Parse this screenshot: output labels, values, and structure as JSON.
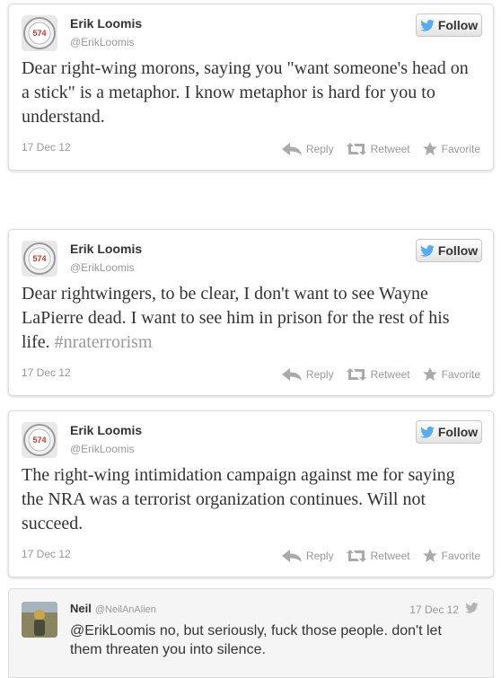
{
  "colors": {
    "twitter_blue": "#55acee",
    "muted": "#999999"
  },
  "tweets": [
    {
      "name": "Erik Loomis",
      "handle": "@ErikLoomis",
      "follow_label": "Follow",
      "text": "Dear right-wing morons, saying you \"want someone's head on a stick\" is a metaphor. I know metaphor is hard for you to understand.",
      "hashtag": "",
      "date": "17 Dec 12",
      "reply_label": "Reply",
      "retweet_label": "Retweet",
      "favorite_label": "Favorite",
      "avatar_text": "574"
    },
    {
      "name": "Erik Loomis",
      "handle": "@ErikLoomis",
      "follow_label": "Follow",
      "text": "Dear rightwingers, to be clear, I don't want to see Wayne LaPierre dead. I want to see him in prison for the rest of his life.",
      "hashtag": "#nraterrorism",
      "date": "17 Dec 12",
      "reply_label": "Reply",
      "retweet_label": "Retweet",
      "favorite_label": "Favorite",
      "avatar_text": "574"
    },
    {
      "name": "Erik Loomis",
      "handle": "@ErikLoomis",
      "follow_label": "Follow",
      "text": "The right-wing intimidation campaign against me for saying the NRA was a terrorist organization continues. Will not succeed.",
      "hashtag": "",
      "date": "17 Dec 12",
      "reply_label": "Reply",
      "retweet_label": "Retweet",
      "favorite_label": "Favorite",
      "avatar_text": "574"
    }
  ],
  "reply": {
    "name": "Neil",
    "handle": "@NeilAnAlien",
    "date": "17 Dec 12",
    "mention": "@ErikLoomis",
    "text": " no, but seriously, fuck those people. don't let them threaten you into silence."
  }
}
